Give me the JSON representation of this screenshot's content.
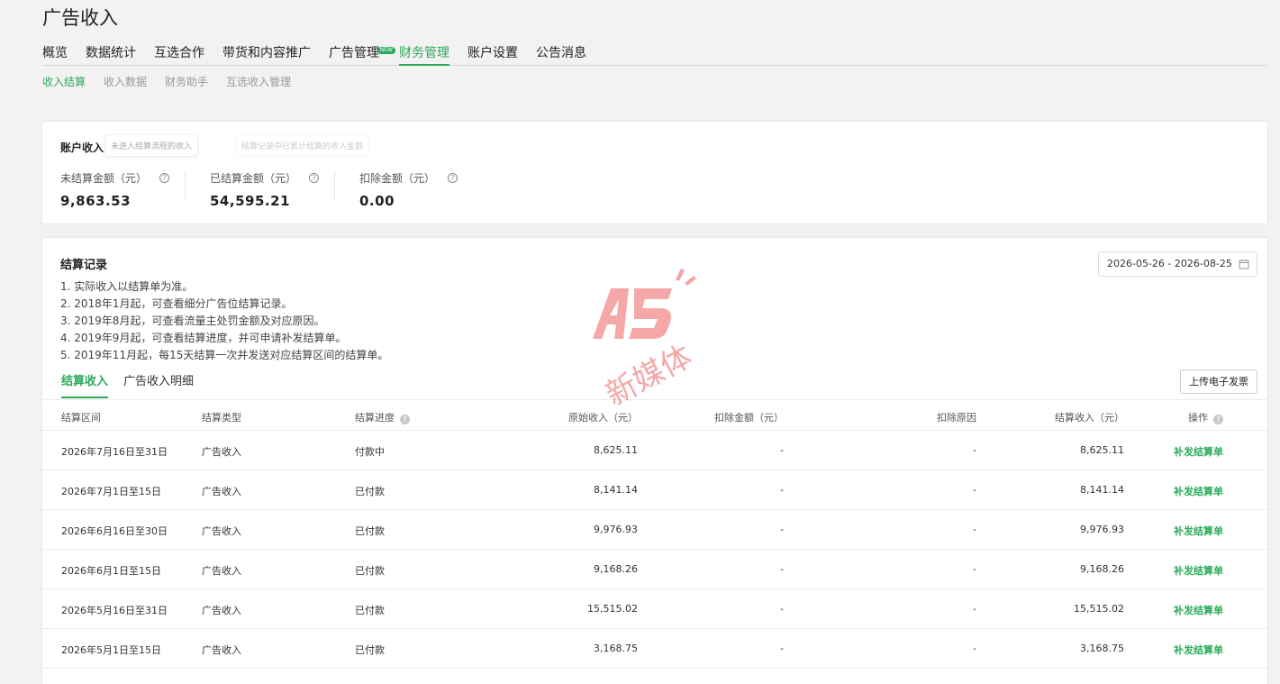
{
  "page": {
    "title": "广告收入"
  },
  "main_nav": [
    {
      "label": "概览"
    },
    {
      "label": "数据统计"
    },
    {
      "label": "互选合作"
    },
    {
      "label": "带货和内容推广"
    },
    {
      "label": "广告管理",
      "badge": "NEW"
    },
    {
      "label": "财务管理",
      "active": true
    },
    {
      "label": "账户设置"
    },
    {
      "label": "公告消息"
    }
  ],
  "sub_nav": [
    {
      "label": "收入结算",
      "active": true
    },
    {
      "label": "收入数据"
    },
    {
      "label": "财务助手"
    },
    {
      "label": "互选收入管理"
    }
  ],
  "account": {
    "title": "账户收入",
    "tip_unsettled": "未进入结算流程的收入",
    "tip_settled": "结算记录中已累计结算的收入金额",
    "metrics": [
      {
        "label": "未结算金额（元）",
        "value": "9,863.53"
      },
      {
        "label": "已结算金额（元）",
        "value": "54,595.21"
      },
      {
        "label": "扣除金额（元）",
        "value": "0.00"
      }
    ]
  },
  "records": {
    "title": "结算记录",
    "notes": [
      "1. 实际收入以结算单为准。",
      "2. 2018年1月起，可查看细分广告位结算记录。",
      "3. 2019年8月起，可查看流量主处罚金额及对应原因。",
      "4. 2019年9月起，可查看结算进度，并可申请补发结算单。",
      "5. 2019年11月起，每15天结算一次并发送对应结算区间的结算单。"
    ],
    "date_range": "2026-05-26 - 2026-08-25",
    "tabs": [
      {
        "label": "结算收入",
        "active": true
      },
      {
        "label": "广告收入明细"
      }
    ],
    "upload_button": "上传电子发票",
    "columns": {
      "period": "结算区间",
      "type": "结算类型",
      "progress": "结算进度",
      "original": "原始收入（元）",
      "deduction": "扣除金额（元）",
      "reason": "扣除原因",
      "settled": "结算收入（元）",
      "action": "操作"
    },
    "rows": [
      {
        "period": "2026年7月16日至31日",
        "type": "广告收入",
        "progress": "付款中",
        "original": "8,625.11",
        "deduction": "-",
        "reason": "-",
        "settled": "8,625.11",
        "action": "补发结算单"
      },
      {
        "period": "2026年7月1日至15日",
        "type": "广告收入",
        "progress": "已付款",
        "original": "8,141.14",
        "deduction": "-",
        "reason": "-",
        "settled": "8,141.14",
        "action": "补发结算单"
      },
      {
        "period": "2026年6月16日至30日",
        "type": "广告收入",
        "progress": "已付款",
        "original": "9,976.93",
        "deduction": "-",
        "reason": "-",
        "settled": "9,976.93",
        "action": "补发结算单"
      },
      {
        "period": "2026年6月1日至15日",
        "type": "广告收入",
        "progress": "已付款",
        "original": "9,168.26",
        "deduction": "-",
        "reason": "-",
        "settled": "9,168.26",
        "action": "补发结算单"
      },
      {
        "period": "2026年5月16日至31日",
        "type": "广告收入",
        "progress": "已付款",
        "original": "15,515.02",
        "deduction": "-",
        "reason": "-",
        "settled": "15,515.02",
        "action": "补发结算单"
      },
      {
        "period": "2026年5月1日至15日",
        "type": "广告收入",
        "progress": "已付款",
        "original": "3,168.75",
        "deduction": "-",
        "reason": "-",
        "settled": "3,168.75",
        "action": "补发结算单"
      }
    ]
  },
  "watermark": {
    "logo": "A5",
    "text": "新媒体"
  },
  "colors": {
    "accent": "#2daa5b",
    "watermark": "#f06060"
  }
}
